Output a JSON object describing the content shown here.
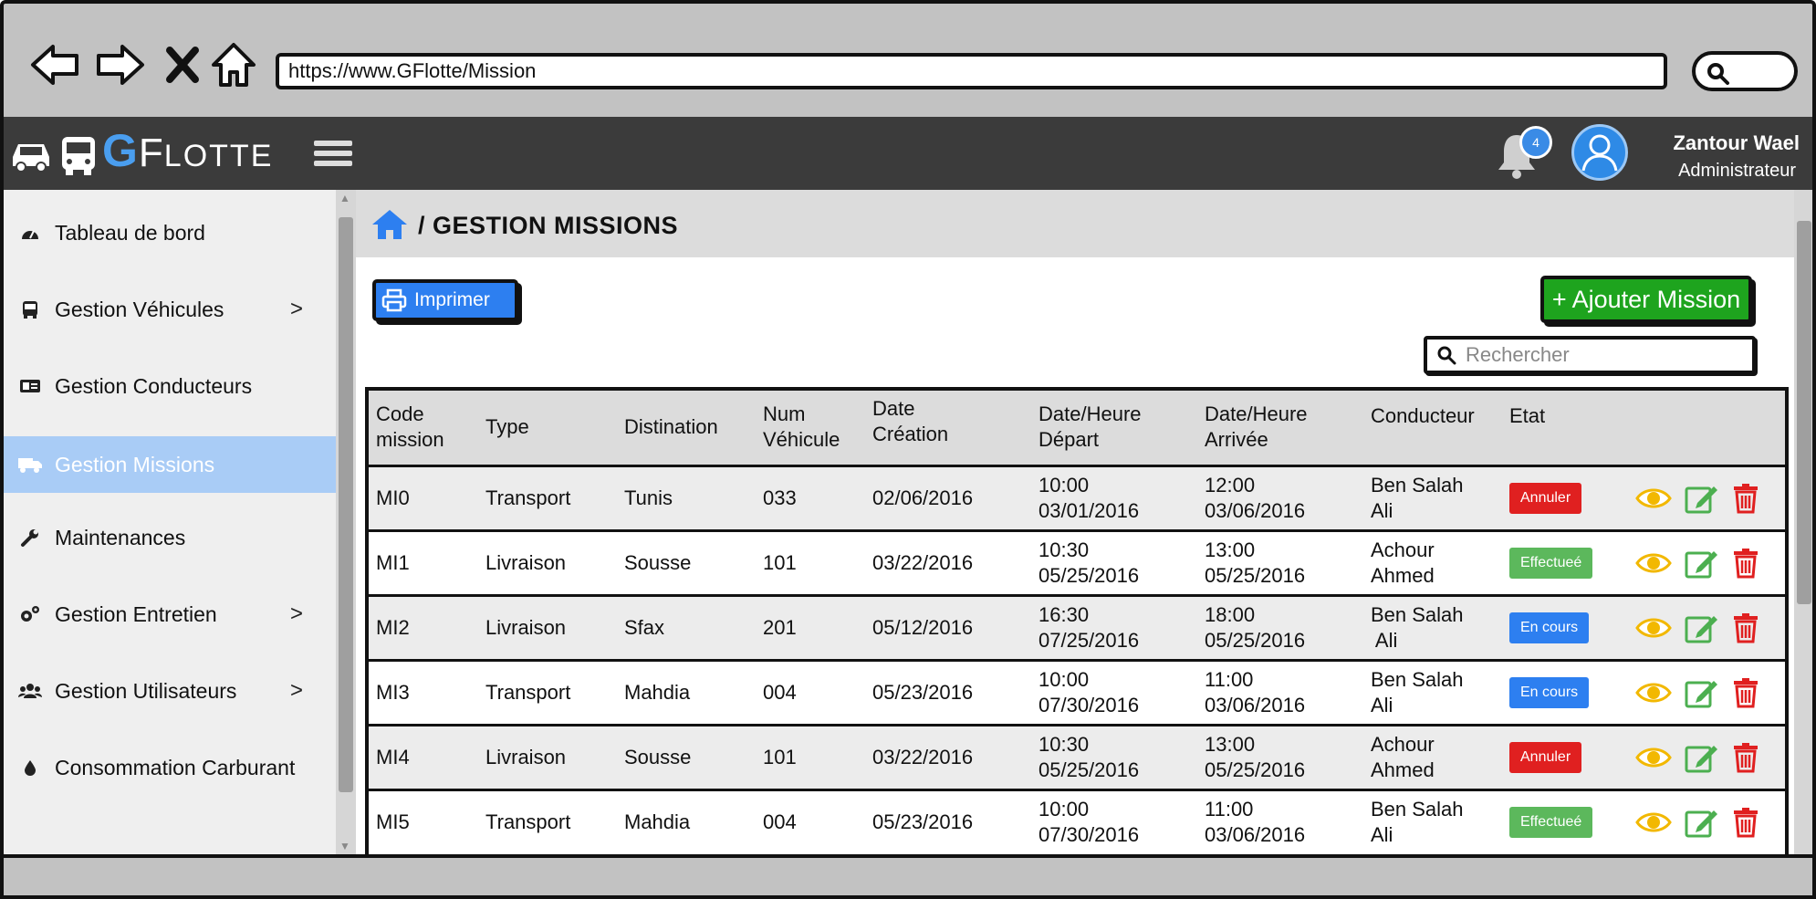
{
  "browser": {
    "url": "https://www.GFlotte/Mission",
    "back_icon": "arrow-left-icon",
    "forward_icon": "arrow-right-icon",
    "stop_icon": "close-icon",
    "home_icon": "home-icon",
    "search_icon": "search-icon"
  },
  "header": {
    "brand_g": "G",
    "brand_f": "F",
    "brand_rest": "LOTTE",
    "notification_count": "4",
    "user_name": "Zantour Wael",
    "user_role": "Administrateur",
    "accent_color": "#4a9eef"
  },
  "sidebar": {
    "items": [
      {
        "label": "Tableau de bord",
        "icon": "dashboard-icon",
        "has_submenu": false,
        "active": false
      },
      {
        "label": "Gestion Véhicules",
        "icon": "bus-icon",
        "has_submenu": true,
        "active": false
      },
      {
        "label": "Gestion Conducteurs",
        "icon": "id-card-icon",
        "has_submenu": false,
        "active": false
      },
      {
        "label": "Gestion Missions",
        "icon": "truck-icon",
        "has_submenu": false,
        "active": true
      },
      {
        "label": "Maintenances",
        "icon": "wrench-icon",
        "has_submenu": false,
        "active": false
      },
      {
        "label": "Gestion Entretien",
        "icon": "gears-icon",
        "has_submenu": true,
        "active": false
      },
      {
        "label": "Gestion Utilisateurs",
        "icon": "users-icon",
        "has_submenu": true,
        "active": false
      },
      {
        "label": "Consommation Carburant",
        "icon": "fuel-drop-icon",
        "has_submenu": false,
        "active": false
      }
    ],
    "chevron": ">"
  },
  "main": {
    "breadcrumb_separator": "/",
    "title": "GESTION MISSIONS",
    "print_label": "Imprimer",
    "add_label": "+ Ajouter Mission",
    "search_placeholder": "Rechercher"
  },
  "table": {
    "columns": [
      [
        "Code",
        "mission"
      ],
      [
        "Type"
      ],
      [
        "Distination"
      ],
      [
        "Num",
        "Véhicule"
      ],
      [
        "Date",
        "Création"
      ],
      [
        "Date/Heure",
        "Départ"
      ],
      [
        "Date/Heure",
        "Arrivée"
      ],
      [
        "Conducteur"
      ],
      [
        "Etat"
      ]
    ],
    "rows": [
      {
        "code": "MI0",
        "type": "Transport",
        "destination": "Tunis",
        "vehicle": "033",
        "created": "02/06/2016",
        "dep_time": "10:00",
        "dep_date": "03/01/2016",
        "arr_time": "12:00",
        "arr_date": "03/06/2016",
        "driver_1": "Ben Salah",
        "driver_2": "Ali",
        "status": "Annuler",
        "status_color": "#e02020"
      },
      {
        "code": "MI1",
        "type": "Livraison",
        "destination": "Sousse",
        "vehicle": "101",
        "created": "03/22/2016",
        "dep_time": "10:30",
        "dep_date": "05/25/2016",
        "arr_time": "13:00",
        "arr_date": "05/25/2016",
        "driver_1": "Achour",
        "driver_2": "Ahmed",
        "status": "Effectueé",
        "status_color": "#5cb85c"
      },
      {
        "code": "MI2",
        "type": "Livraison",
        "destination": "Sfax",
        "vehicle": "201",
        "created": "05/12/2016",
        "dep_time": "16:30",
        "dep_date": "07/25/2016",
        "arr_time": "18:00",
        "arr_date": "05/25/2016",
        "driver_1": "Ben Salah",
        "driver_2": " Ali",
        "status": "En cours",
        "status_color": "#2d7ff0"
      },
      {
        "code": "MI3",
        "type": "Transport",
        "destination": "Mahdia",
        "vehicle": "004",
        "created": "05/23/2016",
        "dep_time": "10:00",
        "dep_date": "07/30/2016",
        "arr_time": "11:00",
        "arr_date": "03/06/2016",
        "driver_1": "Ben Salah",
        "driver_2": "Ali",
        "status": "En cours",
        "status_color": "#2d7ff0"
      },
      {
        "code": "MI4",
        "type": "Livraison",
        "destination": "Sousse",
        "vehicle": "101",
        "created": "03/22/2016",
        "dep_time": "10:30",
        "dep_date": "05/25/2016",
        "arr_time": "13:00",
        "arr_date": "05/25/2016",
        "driver_1": "Achour",
        "driver_2": "Ahmed",
        "status": "Annuler",
        "status_color": "#e02020"
      },
      {
        "code": "MI5",
        "type": "Transport",
        "destination": "Mahdia",
        "vehicle": "004",
        "created": "05/23/2016",
        "dep_time": "10:00",
        "dep_date": "07/30/2016",
        "arr_time": "11:00",
        "arr_date": "03/06/2016",
        "driver_1": "Ben Salah",
        "driver_2": "Ali",
        "status": "Effectueé",
        "status_color": "#5cb85c"
      }
    ],
    "action_icons": [
      "eye-icon",
      "edit-icon",
      "trash-icon"
    ],
    "action_colors": {
      "view": "#f2b800",
      "edit": "#4caf50",
      "delete": "#e02020"
    }
  }
}
